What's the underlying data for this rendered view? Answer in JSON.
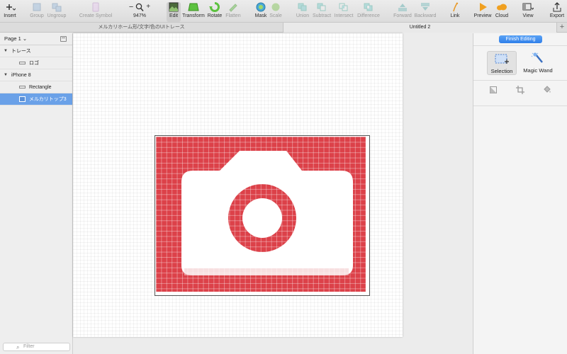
{
  "toolbar": {
    "insert": "Insert",
    "group": "Group",
    "ungroup": "Ungroup",
    "create_symbol": "Create Symbol",
    "zoom_level": "947%",
    "zoom_minus": "−",
    "zoom_plus": "+",
    "edit": "Edit",
    "transform": "Transform",
    "rotate": "Rotate",
    "flatten": "Flatten",
    "mask": "Mask",
    "scale": "Scale",
    "union": "Union",
    "subtract": "Subtract",
    "intersect": "Intersect",
    "difference": "Difference",
    "forward": "Forward",
    "backward": "Backward",
    "link": "Link",
    "preview": "Preview",
    "cloud": "Cloud",
    "view": "View",
    "export": "Export"
  },
  "tabs": {
    "doc1": "メルカリホーム形/文字/色のUIトレース",
    "doc2": "Untitled 2",
    "add": "+"
  },
  "sidebar": {
    "page_selector": "Page 1 ⌄",
    "layers": [
      {
        "label": "トレース",
        "kind": "group"
      },
      {
        "label": "ロゴ",
        "kind": "shape"
      },
      {
        "label": "iPhone 8",
        "kind": "artboard"
      },
      {
        "label": "Rectangle",
        "kind": "shape"
      },
      {
        "label": "メルカリトップ3",
        "kind": "bitmap",
        "selected": true
      }
    ],
    "filter_placeholder": "Filter"
  },
  "inspector": {
    "finish_editing": "Finish Editing",
    "selection": "Selection",
    "magic_wand": "Magic Wand"
  },
  "colors": {
    "accent": "#2f7fea",
    "selected_layer": "#6aa1e8",
    "bitmap_red": "#dc4149",
    "rotate_green": "#5cc23f"
  }
}
